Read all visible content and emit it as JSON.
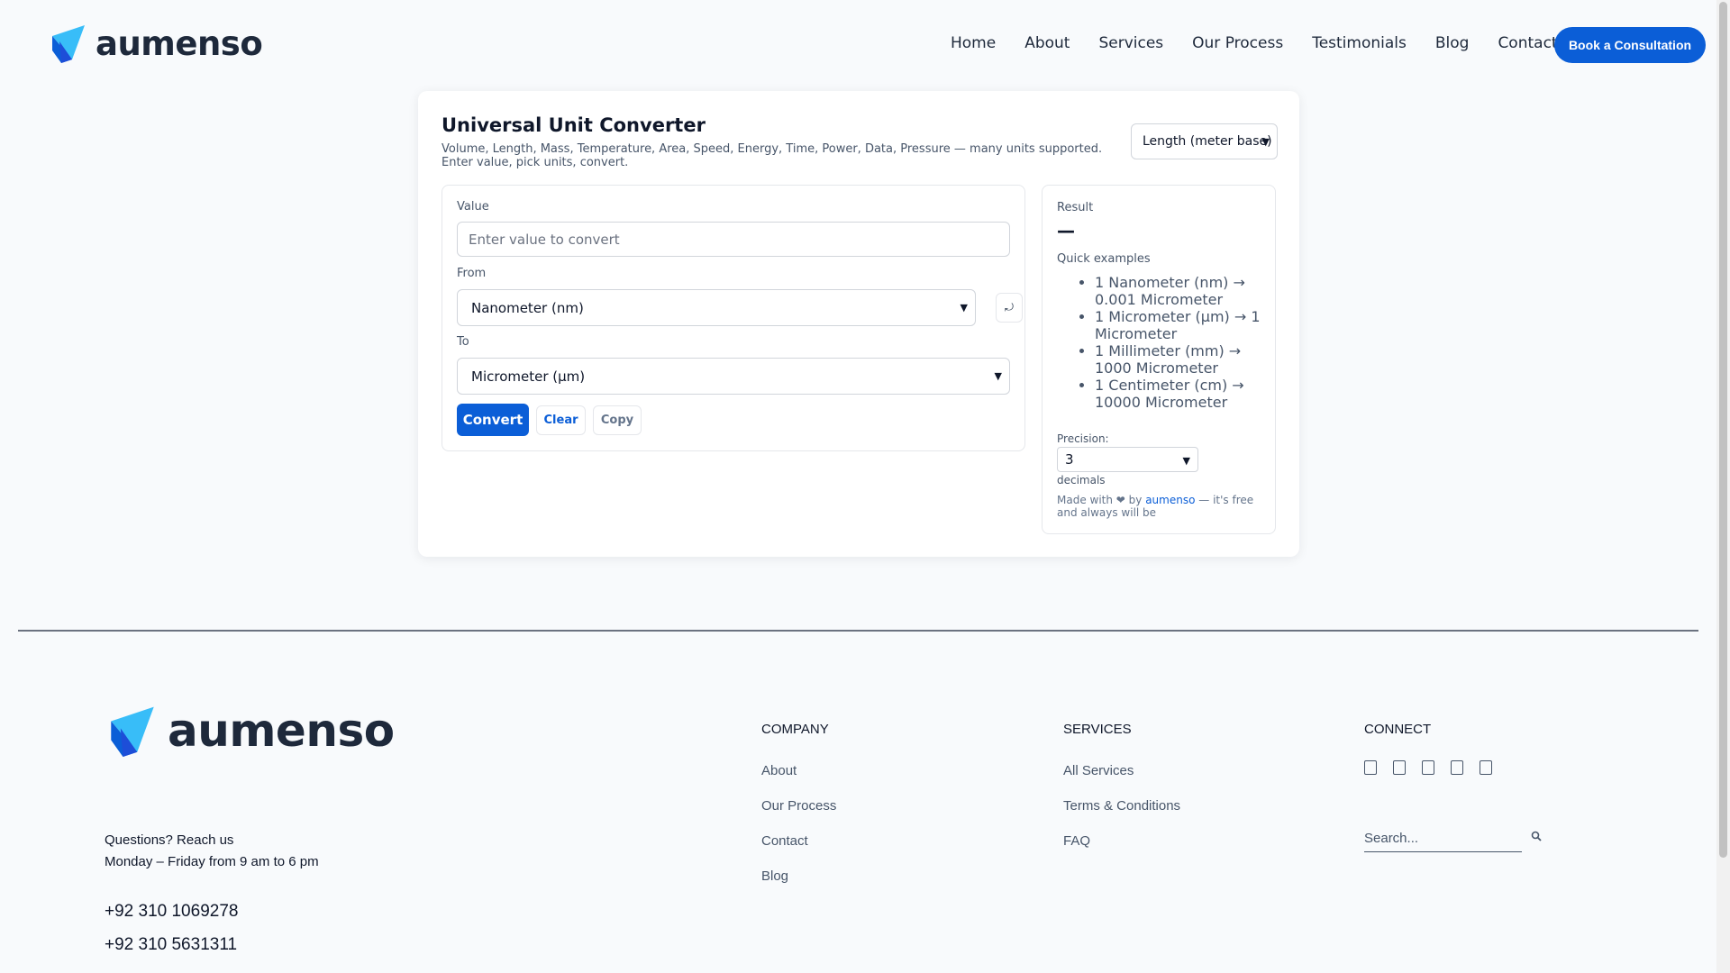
{
  "header": {
    "logo_text": "aumenso",
    "nav": [
      "Home",
      "About",
      "Services",
      "Our Process",
      "Testimonials",
      "Blog",
      "Contact"
    ],
    "cta_label": "Book a Consultation"
  },
  "converter": {
    "title": "Universal Unit Converter",
    "subtitle": "Volume, Length, Mass, Temperature, Area, Speed, Energy, Time, Power, Data, Pressure — many units supported. Enter value, pick units, convert.",
    "category_selected": "Length (meter base)",
    "value_label": "Value",
    "value_placeholder": "Enter value to convert",
    "from_label": "From",
    "from_selected": "Nanometer (nm)",
    "swap_symbol": "⤾",
    "to_label": "To",
    "to_selected": "Micrometer (µm)",
    "convert_label": "Convert",
    "clear_label": "Clear",
    "copy_label": "Copy"
  },
  "result": {
    "label": "Result",
    "value": "—",
    "examples_label": "Quick examples",
    "examples": [
      "1 Nanometer (nm) → 0.001 Micrometer",
      "1 Micrometer (µm) → 1 Micrometer",
      "1 Millimeter (mm) → 1000 Micrometer",
      "1 Centimeter (cm) → 10000 Micrometer"
    ],
    "precision_label": "Precision:",
    "precision_value": "3",
    "decimals_label": "decimals",
    "made_prefix": "Made with ❤ by ",
    "made_brand": "aumenso",
    "made_suffix": " — it's free and always will be"
  },
  "footer": {
    "logo_text": "aumenso",
    "question": "Questions? Reach us",
    "hours": "Monday – Friday from 9 am to 6 pm",
    "phone1": "+92 310 1069278",
    "phone2": "+92 310 5631311",
    "company_title": "COMPANY",
    "company_links": [
      "About",
      "Our Process",
      "Contact",
      "Blog"
    ],
    "services_title": "SERVICES",
    "services_links": [
      "All Services",
      "Terms & Conditions",
      "FAQ"
    ],
    "connect_title": "CONNECT",
    "search_placeholder": "Search..."
  },
  "colors": {
    "accent": "#0b5ed7",
    "logo_light": "#38bdf8",
    "logo_dark": "#0b5ed7"
  }
}
